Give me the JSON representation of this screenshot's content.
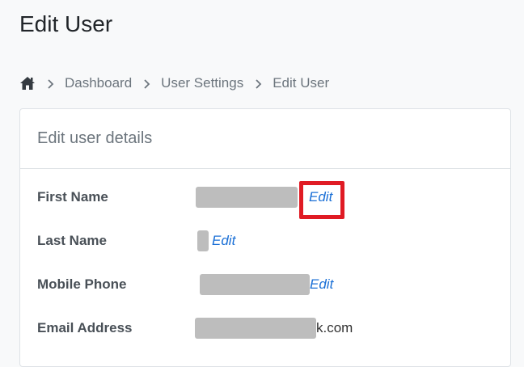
{
  "page": {
    "title": "Edit User"
  },
  "breadcrumb": {
    "home_icon": "home-icon",
    "items": [
      "Dashboard",
      "User Settings",
      "Edit User"
    ]
  },
  "card": {
    "title": "Edit user details",
    "fields": [
      {
        "label": "First Name",
        "value_suffix": "",
        "edit_label": "Edit"
      },
      {
        "label": "Last Name",
        "value_suffix": "",
        "edit_label": "Edit"
      },
      {
        "label": "Mobile Phone",
        "value_suffix": "",
        "edit_label": "Edit"
      },
      {
        "label": "Email Address",
        "value_suffix": "k.com",
        "edit_label": ""
      }
    ]
  },
  "colors": {
    "link": "#1a6fd6",
    "highlight": "#e01b24",
    "redaction": "#bdbdbd"
  }
}
